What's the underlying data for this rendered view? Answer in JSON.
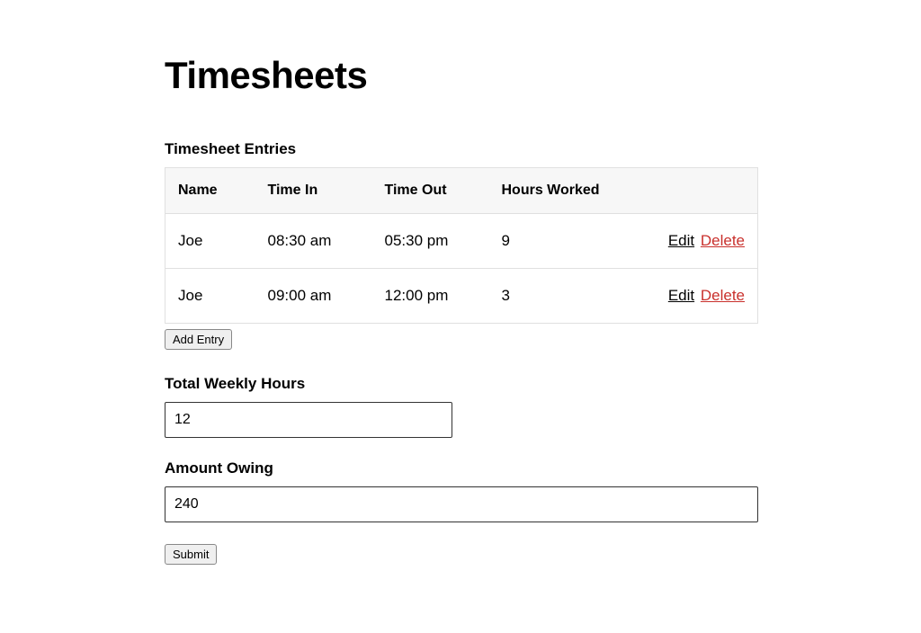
{
  "page": {
    "title": "Timesheets"
  },
  "entries": {
    "heading": "Timesheet Entries",
    "columns": {
      "name": "Name",
      "time_in": "Time In",
      "time_out": "Time Out",
      "hours_worked": "Hours Worked"
    },
    "actions": {
      "edit": "Edit",
      "delete": "Delete"
    },
    "rows": [
      {
        "name": "Joe",
        "time_in": "08:30 am",
        "time_out": "05:30 pm",
        "hours_worked": "9"
      },
      {
        "name": "Joe",
        "time_in": "09:00 am",
        "time_out": "12:00 pm",
        "hours_worked": "3"
      }
    ],
    "add_button": "Add Entry"
  },
  "totals": {
    "weekly_hours_label": "Total Weekly Hours",
    "weekly_hours_value": "12",
    "amount_owing_label": "Amount Owing",
    "amount_owing_value": "240"
  },
  "submit": {
    "label": "Submit"
  }
}
